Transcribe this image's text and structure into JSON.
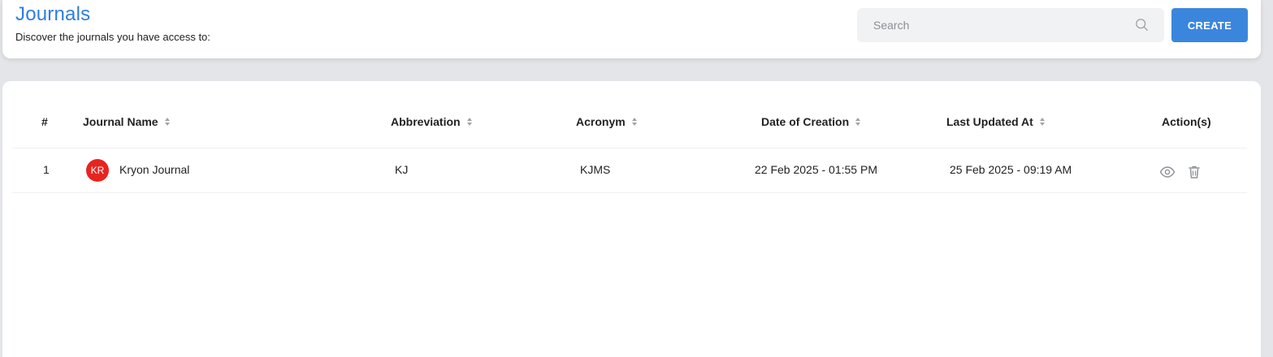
{
  "header": {
    "title": "Journals",
    "subtitle": "Discover the journals you have access to:",
    "search_placeholder": "Search",
    "create_label": "CREATE"
  },
  "colors": {
    "accent": "#2f7de1",
    "button": "#3b86dd",
    "avatar": "#e8241f"
  },
  "table": {
    "headers": {
      "index": "#",
      "journal_name": "Journal Name",
      "abbreviation": "Abbreviation",
      "acronym": "Acronym",
      "date_of_creation": "Date of Creation",
      "last_updated_at": "Last Updated At",
      "actions": "Action(s)"
    },
    "rows": [
      {
        "index": "1",
        "avatar": "KR",
        "journal_name": "Kryon Journal",
        "abbreviation": "KJ",
        "acronym": "KJMS",
        "date_of_creation": "22 Feb 2025 - 01:55 PM",
        "last_updated_at": "25 Feb 2025 - 09:19 AM",
        "actions": [
          "eye-icon",
          "trash-icon"
        ]
      }
    ]
  }
}
